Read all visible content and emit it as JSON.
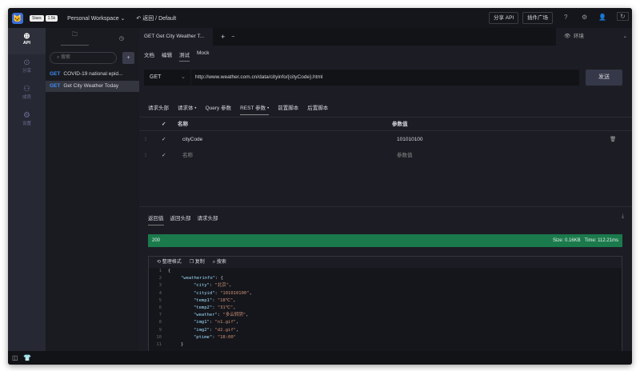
{
  "topbar": {
    "star": "Stars",
    "star_count": "1.5k",
    "workspace": "Personal Workspace",
    "back": "返回",
    "project": "Default",
    "share_api": "分享 API",
    "plugin_market": "插件广场"
  },
  "sidebar": {
    "items": [
      {
        "label": "API"
      },
      {
        "label": "分享"
      },
      {
        "label": "成员"
      },
      {
        "label": "设置"
      }
    ]
  },
  "list": {
    "search_placeholder": "搜索",
    "items": [
      {
        "method": "GET",
        "name": "COVID-19 national epid..."
      },
      {
        "method": "GET",
        "name": "Get City Weather Today"
      }
    ]
  },
  "tabs": {
    "active": "GET Get City Weather T...",
    "env": "环境"
  },
  "subtabs": [
    "文档",
    "编辑",
    "测试",
    "Mock"
  ],
  "request": {
    "method": "GET",
    "url": "http://www.weather.com.cn/data/cityinfo/{cityCode}.html",
    "send": "发送"
  },
  "request_tabs": [
    "请求头部",
    "请求体 •",
    "Query 参数",
    "REST 参数 •",
    "前置脚本",
    "后置脚本"
  ],
  "params": {
    "headers": [
      "名称",
      "参数值"
    ],
    "rows": [
      {
        "name": "cityCode",
        "value": "101010100"
      },
      {
        "name": "名称",
        "value": "参数值"
      }
    ]
  },
  "response": {
    "tabs": [
      "返回值",
      "返回头部",
      "请求头部"
    ],
    "status": "200",
    "size": "Size: 0.16KB",
    "time": "Time: 112.21ms",
    "tools": [
      "整理格式",
      "复制",
      "搜索"
    ],
    "lines": [
      {
        "n": "1",
        "t": "{"
      },
      {
        "n": "2",
        "k": "\"weatherinfo\"",
        "t": ": {",
        "i": 1
      },
      {
        "n": "3",
        "k": "\"city\"",
        "v": "\"北京\"",
        "i": 2
      },
      {
        "n": "4",
        "k": "\"cityid\"",
        "v": "\"101010100\"",
        "i": 2
      },
      {
        "n": "5",
        "k": "\"temp1\"",
        "v": "\"18℃\"",
        "i": 2
      },
      {
        "n": "6",
        "k": "\"temp2\"",
        "v": "\"31℃\"",
        "i": 2
      },
      {
        "n": "7",
        "k": "\"weather\"",
        "v": "\"多云转阴\"",
        "i": 2
      },
      {
        "n": "8",
        "k": "\"img1\"",
        "v": "\"n1.gif\"",
        "i": 2
      },
      {
        "n": "9",
        "k": "\"img2\"",
        "v": "\"d2.gif\"",
        "i": 2
      },
      {
        "n": "10",
        "k": "\"ptime\"",
        "v": "\"18:00\"",
        "i": 2,
        "last": true
      },
      {
        "n": "11",
        "t": "}",
        "i": 1
      }
    ]
  }
}
